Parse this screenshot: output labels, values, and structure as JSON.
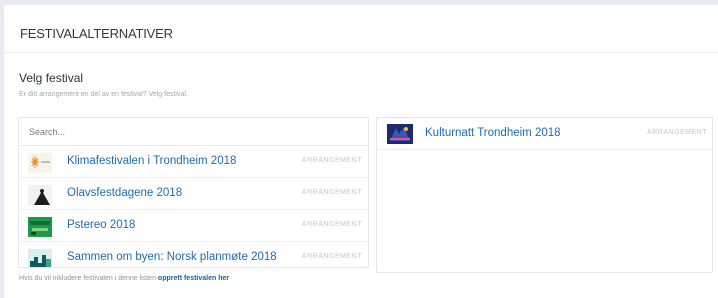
{
  "section": {
    "title": "FESTIVALALTERNATIVER"
  },
  "field": {
    "label": "Velg festival",
    "hint": "Er ditt arrangement en del av en festival? Velg festival."
  },
  "search": {
    "placeholder": "Search..."
  },
  "festival_list": [
    {
      "title": "Klimafestivalen i Trondheim 2018",
      "type": "ARRANGEMENT"
    },
    {
      "title": "Olavsfestdagene 2018",
      "type": "ARRANGEMENT"
    },
    {
      "title": "Pstereo 2018",
      "type": "ARRANGEMENT"
    },
    {
      "title": "Sammen om byen: Norsk planmøte 2018",
      "type": "ARRANGEMENT"
    }
  ],
  "selected": [
    {
      "title": "Kulturnatt Trondheim 2018",
      "type": "ARRANGEMENT"
    }
  ],
  "footer": {
    "text": "Hvis du vil inkludere festivalen i denne listen",
    "link": "opprett festivalen her"
  },
  "colors": {
    "link": "#1f6bb0",
    "muted": "#c3c6cb",
    "background": "#e9ebf2"
  }
}
